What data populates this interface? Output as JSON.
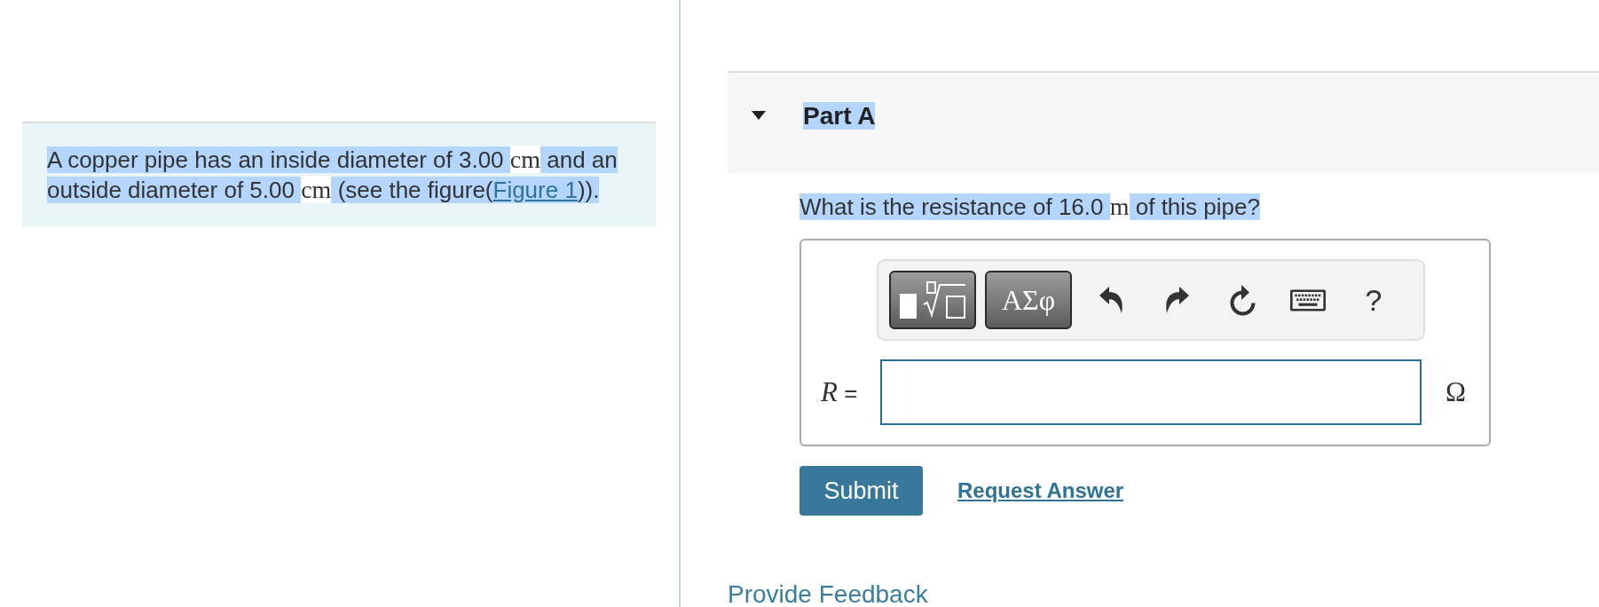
{
  "problem": {
    "highlighted": true,
    "segments": [
      {
        "kind": "text",
        "text": "A copper pipe has an inside diameter of 3.00 "
      },
      {
        "kind": "math",
        "text": "cm"
      },
      {
        "kind": "text",
        "text": " and an outside diameter of 5.00 "
      },
      {
        "kind": "math",
        "text": "cm"
      },
      {
        "kind": "text",
        "text": " (see the figure("
      },
      {
        "kind": "link",
        "text": "Figure 1"
      },
      {
        "kind": "text",
        "text": "))."
      }
    ]
  },
  "part": {
    "title": "Part A",
    "expanded": true,
    "highlighted": true
  },
  "question": {
    "highlighted": true,
    "segments": [
      {
        "kind": "text",
        "text": "What is the resistance of 16.0 "
      },
      {
        "kind": "math",
        "text": "m"
      },
      {
        "kind": "text",
        "text": " of this pipe?"
      }
    ]
  },
  "answer": {
    "toolbar": [
      {
        "kind": "templates"
      },
      {
        "kind": "symbols",
        "label": "ΑΣφ"
      },
      {
        "kind": "undo"
      },
      {
        "kind": "redo"
      },
      {
        "kind": "reset"
      },
      {
        "kind": "keyboard"
      },
      {
        "kind": "help",
        "label": "?"
      }
    ],
    "variable": "R",
    "relation": "=",
    "unit": "Ω"
  },
  "actions": {
    "submit": "Submit",
    "request_answer": "Request Answer"
  },
  "feedback": "Provide Feedback"
}
